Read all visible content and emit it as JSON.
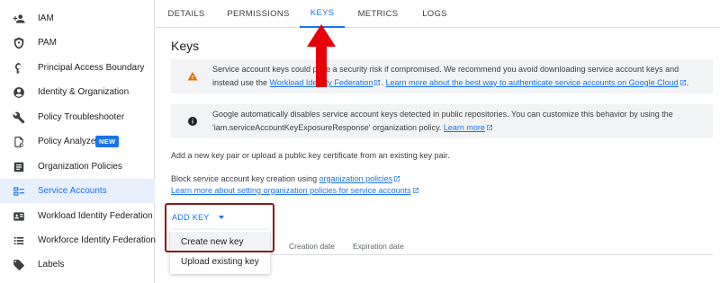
{
  "sidebar": {
    "items": [
      {
        "label": "IAM",
        "icon": "person-add-icon"
      },
      {
        "label": "PAM",
        "icon": "shield-icon"
      },
      {
        "label": "Principal Access Boundary",
        "icon": "boundary-icon"
      },
      {
        "label": "Identity & Organization",
        "icon": "account-circle-icon"
      },
      {
        "label": "Policy Troubleshooter",
        "icon": "wrench-icon"
      },
      {
        "label": "Policy Analyzer",
        "icon": "policy-analyzer-icon",
        "badge": "NEW"
      },
      {
        "label": "Organization Policies",
        "icon": "document-list-icon"
      },
      {
        "label": "Service Accounts",
        "icon": "service-account-icon",
        "active": true
      },
      {
        "label": "Workload Identity Federation",
        "icon": "id-card-icon"
      },
      {
        "label": "Workforce Identity Federation",
        "icon": "list-icon"
      },
      {
        "label": "Labels",
        "icon": "label-icon"
      }
    ]
  },
  "tabs": [
    {
      "label": "DETAILS"
    },
    {
      "label": "PERMISSIONS"
    },
    {
      "label": "KEYS",
      "active": true
    },
    {
      "label": "METRICS"
    },
    {
      "label": "LOGS"
    }
  ],
  "main": {
    "title": "Keys",
    "warning": {
      "text_1": "Service account keys could pose a security risk if compromised. We recommend you avoid downloading service account keys and instead use the ",
      "link_1": "Workload Identity Federation",
      "text_2": ". ",
      "link_2": "Learn more about the best way to authenticate service accounts on Google Cloud",
      "text_3": "."
    },
    "info": {
      "text_1": "Google automatically disables service account keys detected in public repositories. You can customize this behavior by using the 'iam.serviceAccountKeyExposureResponse' organization policy. ",
      "link_1": "Learn more"
    },
    "add_key_desc": "Add a new key pair or upload a public key certificate from an existing key pair.",
    "block_text": "Block service account key creation using ",
    "block_link": "organization policies",
    "learn_more_link": "Learn more about setting organization policies for service accounts",
    "add_key_button": "ADD KEY",
    "menu": {
      "create": "Create new key",
      "upload": "Upload existing key"
    },
    "table": {
      "columns": [
        "Creation date",
        "Expiration date"
      ]
    }
  },
  "colors": {
    "accent": "#1a73e8",
    "warning": "#e37400",
    "arrow": "#e8000b",
    "highlight_border": "#8b1a1a"
  }
}
